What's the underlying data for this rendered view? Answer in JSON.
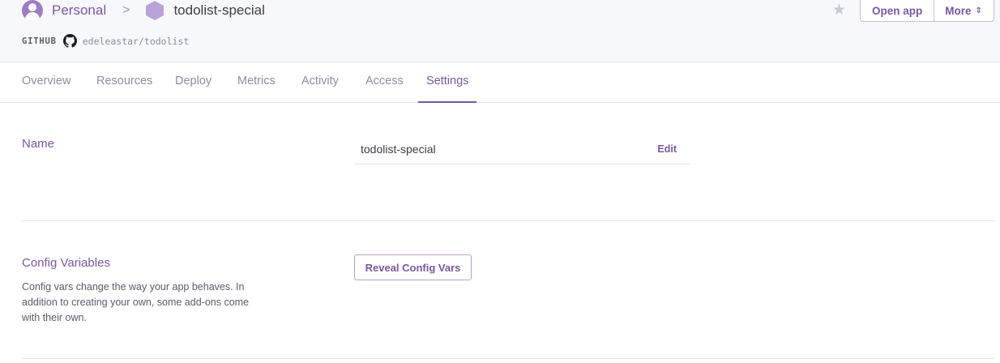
{
  "header": {
    "personal_label": "Personal",
    "separator": ">",
    "app_name": "todolist-special",
    "repo_label": "GITHUB",
    "repo_name": "edeleastar/todolist",
    "open_app_label": "Open app",
    "more_label": "More"
  },
  "tabs": [
    {
      "label": "Overview",
      "active": false
    },
    {
      "label": "Resources",
      "active": false
    },
    {
      "label": "Deploy",
      "active": false
    },
    {
      "label": "Metrics",
      "active": false
    },
    {
      "label": "Activity",
      "active": false
    },
    {
      "label": "Access",
      "active": false
    },
    {
      "label": "Settings",
      "active": true
    }
  ],
  "name_section": {
    "title": "Name",
    "value": "todolist-special",
    "edit_label": "Edit"
  },
  "config_section": {
    "title": "Config Variables",
    "description": "Config vars change the way your app behaves. In addition to creating your own, some add-ons come with their own.",
    "reveal_label": "Reveal Config Vars"
  },
  "icons": {
    "avatar": "user-avatar-icon",
    "app": "hexagon-app-icon",
    "repo": "github-icon",
    "star": "star-icon",
    "more_chevron": "chevron-up-down-icon"
  },
  "colors": {
    "accent": "#79589f",
    "header_bg": "#f7f8fb",
    "text": "#3f3f44",
    "muted": "#8e8fa0",
    "border": "#e3e5ec"
  }
}
